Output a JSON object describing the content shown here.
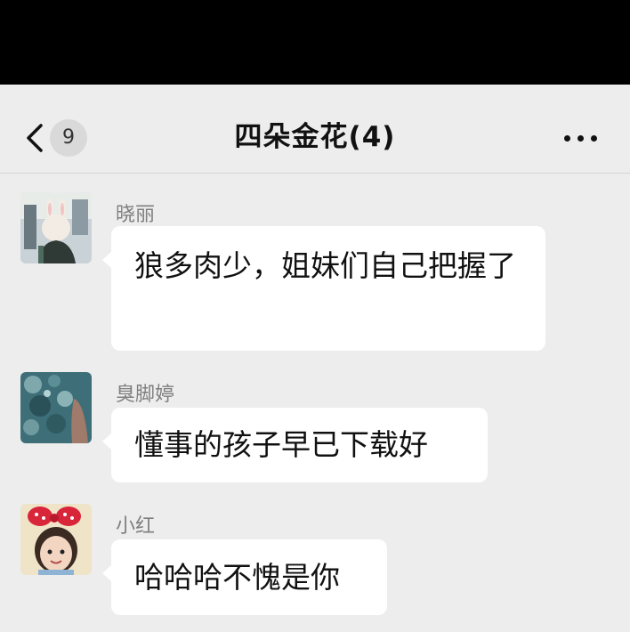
{
  "header": {
    "title": "四朵金花(4)",
    "unread_count": "9",
    "back_icon": "chevron-left-icon",
    "more_icon": "more-dots-icon"
  },
  "messages": [
    {
      "sender": "晓丽",
      "text": "狼多肉少，姐妹们自己把握了",
      "avatar": "avatar-rabbit-girl"
    },
    {
      "sender": "臭脚婷",
      "text": "懂事的孩子早已下载好",
      "avatar": "avatar-ocean-rocks"
    },
    {
      "sender": "小红",
      "text": "哈哈哈不愧是你",
      "avatar": "avatar-girl-red-bow"
    }
  ],
  "colors": {
    "background": "#ededed",
    "bubble": "#ffffff",
    "status_bar": "#000000"
  }
}
